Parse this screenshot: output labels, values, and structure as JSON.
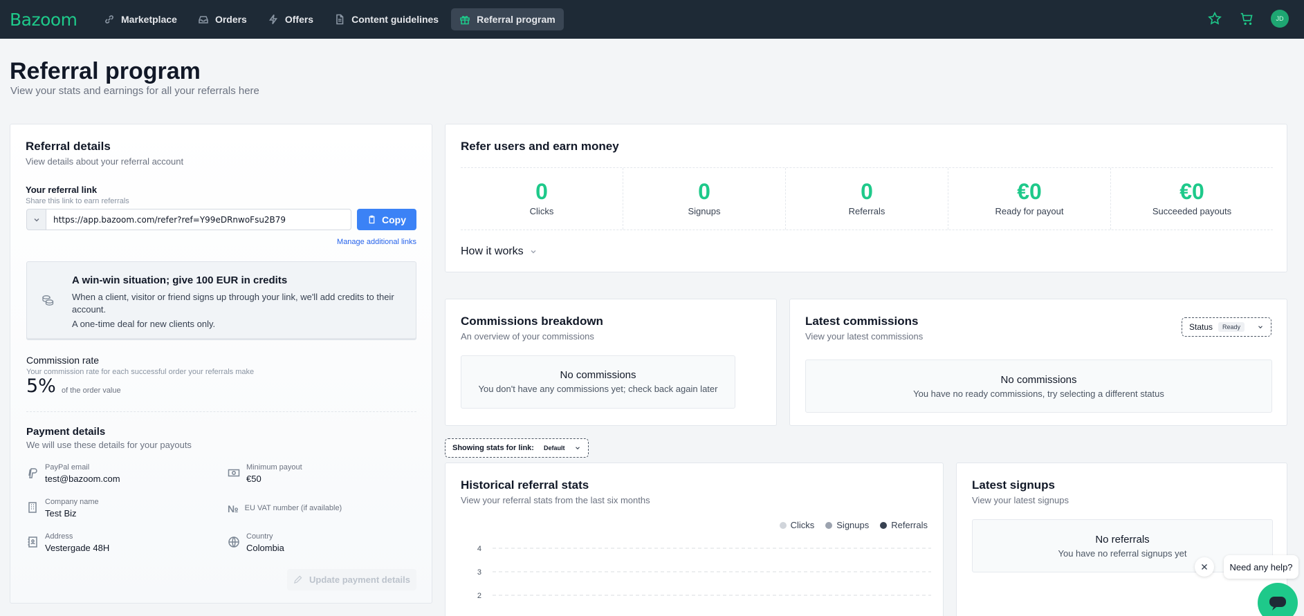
{
  "nav": {
    "logo": "Bazoom",
    "items": [
      {
        "label": "Marketplace",
        "icon": "link-icon"
      },
      {
        "label": "Orders",
        "icon": "inbox-icon"
      },
      {
        "label": "Offers",
        "icon": "bolt-icon"
      },
      {
        "label": "Content guidelines",
        "icon": "document-icon"
      },
      {
        "label": "Referral program",
        "icon": "gift-icon"
      }
    ],
    "avatar_initials": "JD",
    "accent_color": "#1ec98a"
  },
  "page": {
    "title": "Referral program",
    "subtitle": "View your stats and earnings for all your referrals here"
  },
  "referral_details": {
    "title": "Referral details",
    "subtitle": "View details about your referral account",
    "link_label": "Your referral link",
    "link_hint": "Share this link to earn referrals",
    "link_value": "https://app.bazoom.com/refer?ref=Y99eDRnwoFsu2B79",
    "copy_label": "Copy",
    "manage_label": "Manage additional links",
    "winwin_title": "A win-win situation; give 100 EUR in credits",
    "winwin_text": "When a client, visitor or friend signs up through your link, we'll add credits to their account.",
    "winwin_note": "A one-time deal for new clients only.",
    "commission_label": "Commission rate",
    "commission_hint": "Your commission rate for each successful order your referrals make",
    "commission_value": "5%",
    "commission_suffix": "of the order value"
  },
  "payment": {
    "title": "Payment details",
    "subtitle": "We will use these details for your payouts",
    "paypal_label": "PayPal email",
    "paypal_value": "test@bazoom.com",
    "min_label": "Minimum payout",
    "min_value": "€50",
    "company_label": "Company name",
    "company_value": "Test Biz",
    "vat_label": "EU VAT number (if available)",
    "address_label": "Address",
    "address_value": "Vestergade 48H",
    "country_label": "Country",
    "country_value": "Colombia",
    "update_label": "Update payment details"
  },
  "refer": {
    "title": "Refer users and earn money",
    "stats": [
      {
        "value": "0",
        "label": "Clicks"
      },
      {
        "value": "0",
        "label": "Signups"
      },
      {
        "value": "0",
        "label": "Referrals"
      },
      {
        "value": "€0",
        "label": "Ready for payout"
      },
      {
        "value": "€0",
        "label": "Succeeded payouts"
      }
    ],
    "how_label": "How it works"
  },
  "commissions_breakdown": {
    "title": "Commissions breakdown",
    "subtitle": "An overview of your commissions",
    "empty_title": "No commissions",
    "empty_text": "You don't have any commissions yet; check back again later"
  },
  "latest_commissions": {
    "title": "Latest commissions",
    "subtitle": "View your latest commissions",
    "status_label": "Status",
    "status_value": "Ready",
    "empty_title": "No commissions",
    "empty_text": "You have no ready commissions, try selecting a different status"
  },
  "showing": {
    "label": "Showing stats for link:",
    "value": "Default"
  },
  "historical": {
    "title": "Historical referral stats",
    "subtitle": "View your referral stats from the last six months"
  },
  "chart_data": {
    "type": "line",
    "series": [
      {
        "name": "Clicks",
        "color": "#d1d5db"
      },
      {
        "name": "Signups",
        "color": "#9ca3af"
      },
      {
        "name": "Referrals",
        "color": "#374151"
      }
    ],
    "y_ticks": [
      "4",
      "3",
      "2"
    ],
    "grid": true
  },
  "signups": {
    "title": "Latest signups",
    "subtitle": "View your latest signups",
    "empty_title": "No referrals",
    "empty_text": "You have no referral signups yet"
  },
  "help": {
    "label": "Need any help?"
  }
}
